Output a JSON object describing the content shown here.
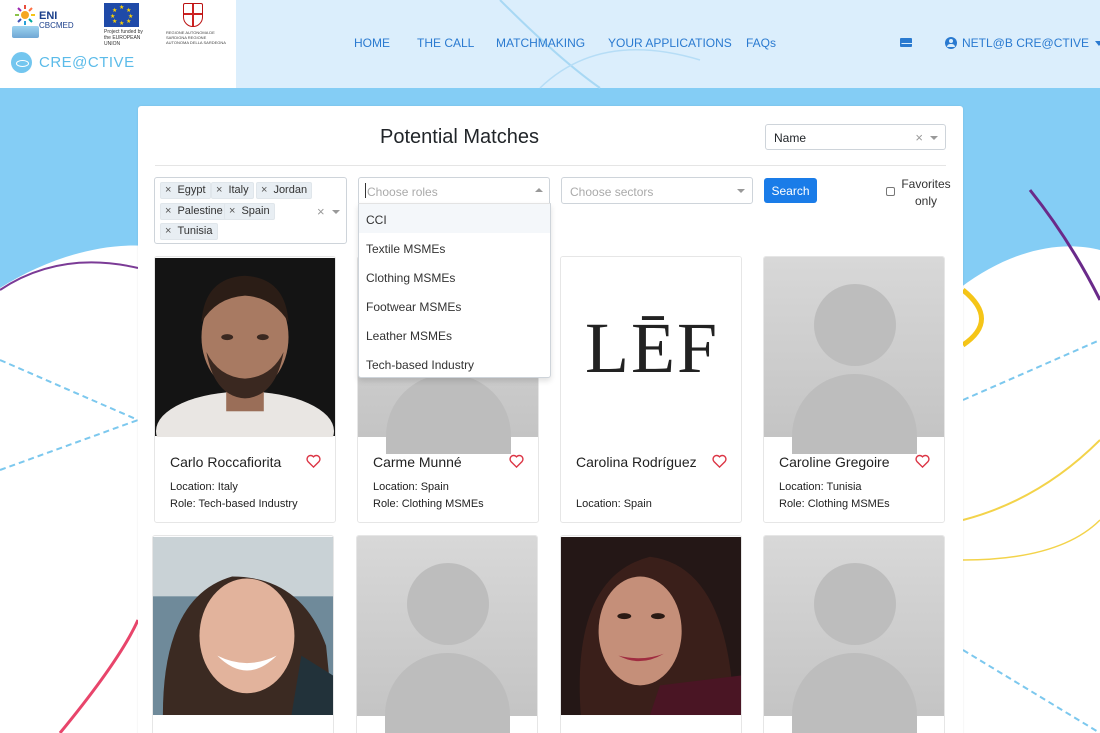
{
  "header": {
    "eni_title": "ENI",
    "eni_subtitle": "CBCMED",
    "eu_caption": "Project funded by the EUROPEAN UNION",
    "sardegna_caption": "REGIONE AUTONOMA DE SARDIGNA REGIONE AUTONOMA DELLA SARDEGNA",
    "brand": "CRE@CTIVE",
    "nav": [
      "HOME",
      "THE CALL",
      "MATCHMAKING",
      "YOUR APPLICATIONS",
      "FAQs"
    ],
    "mail_icon": "envelope-icon",
    "user_label": "NETL@B CRE@CTIVE"
  },
  "page": {
    "title": "Potential Matches",
    "sort": {
      "value": "Name",
      "clear": "×"
    }
  },
  "filters": {
    "countries": [
      "Egypt",
      "Italy",
      "Jordan",
      "Palestine",
      "Spain",
      "Tunisia"
    ],
    "chip_remove": "×",
    "countries_clear": "×",
    "roles_placeholder": "Choose roles",
    "roles_options": [
      "CCI",
      "Textile MSMEs",
      "Clothing MSMEs",
      "Footwear MSMEs",
      "Leather MSMEs",
      "Tech-based Industry"
    ],
    "sectors_placeholder": "Choose sectors",
    "search_label": "Search",
    "favorites_label": "Favorites only"
  },
  "profiles": [
    {
      "name": "Carlo Roccafiorita",
      "location": "Location: Italy",
      "role": "Role: Tech-based Industry"
    },
    {
      "name": "Carme Munné",
      "location": "Location: Spain",
      "role": "Role: Clothing MSMEs"
    },
    {
      "name": "Carolina Rodríguez",
      "location": "Location: Spain",
      "role": "",
      "logo_text": "LĒF"
    },
    {
      "name": "Caroline Gregoire",
      "location": "Location: Tunisia",
      "role": "Role: Clothing MSMEs"
    }
  ],
  "colors": {
    "accent": "#1a7ce8",
    "nav_text": "#2a7ad0",
    "header_bg": "#dbeefc",
    "band_bg": "#84cdf5",
    "heart": "#dc3545"
  }
}
